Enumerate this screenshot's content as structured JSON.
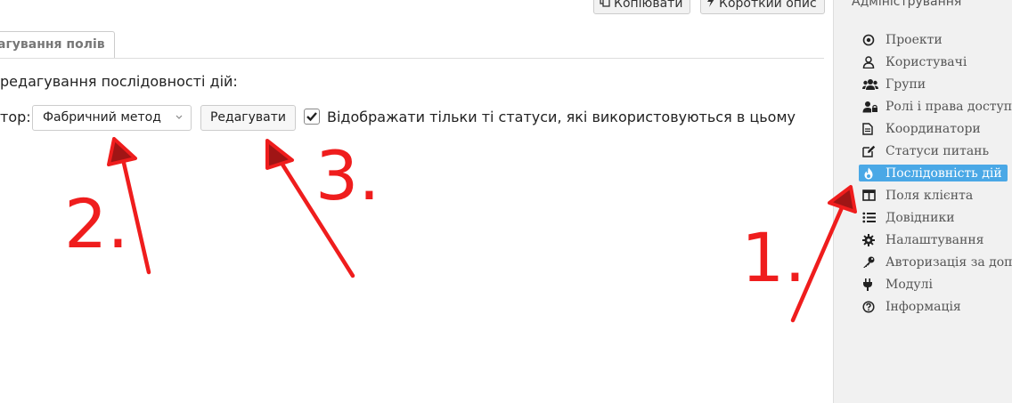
{
  "toolbar": {
    "copy_label": "Копіювати",
    "short_desc_label": "Короткий опис"
  },
  "tab": {
    "label": "агування полів"
  },
  "main": {
    "description": "редагування послідовності дій:",
    "row_label": "тор:",
    "select_value": "Фабричний метод",
    "edit_button": "Редагувати",
    "checkbox_checked": true,
    "checkbox_label": "Відображати тільки ті статуси, які використовуються в цьому"
  },
  "sidebar": {
    "title": "Адміністрування",
    "items": [
      {
        "label": "Проекти",
        "icon": "target-icon"
      },
      {
        "label": "Користувачі",
        "icon": "user-icon"
      },
      {
        "label": "Групи",
        "icon": "users-icon"
      },
      {
        "label": "Ролі і права доступу",
        "icon": "user-lock-icon"
      },
      {
        "label": "Координатори",
        "icon": "document-icon"
      },
      {
        "label": "Статуси питань",
        "icon": "edit-icon"
      },
      {
        "label": "Послідовність дій",
        "icon": "fire-icon",
        "active": true
      },
      {
        "label": "Поля клієнта",
        "icon": "columns-icon"
      },
      {
        "label": "Довідники",
        "icon": "list-icon"
      },
      {
        "label": "Налаштування",
        "icon": "gear-icon"
      },
      {
        "label": "Авторизація за допомогою",
        "icon": "key-icon"
      },
      {
        "label": "Модулі",
        "icon": "plug-icon"
      },
      {
        "label": "Інформація",
        "icon": "help-icon"
      }
    ]
  },
  "annotations": {
    "color": "#ef1d1d",
    "labels": [
      "1.",
      "2.",
      "3."
    ]
  }
}
